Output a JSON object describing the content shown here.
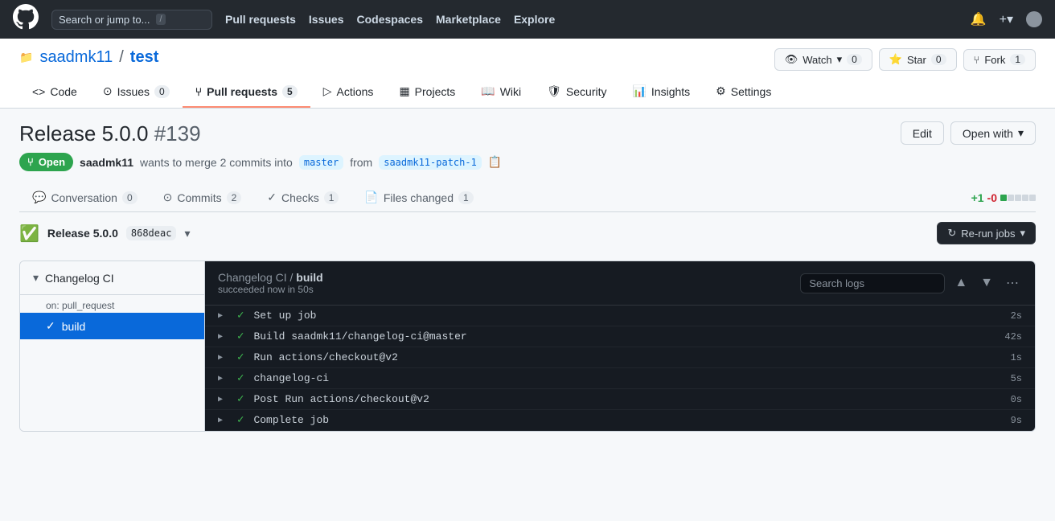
{
  "topnav": {
    "search_placeholder": "Search or jump to...",
    "slash_key": "/",
    "nav_items": [
      "Pull requests",
      "Issues",
      "Codespaces",
      "Marketplace",
      "Explore"
    ],
    "watch_label": "Watch",
    "watch_count": "0",
    "star_label": "Star",
    "star_count": "0",
    "fork_label": "Fork",
    "fork_count": "1"
  },
  "repo": {
    "owner": "saadmk11",
    "name": "test",
    "tabs": [
      {
        "icon": "code-icon",
        "label": "Code"
      },
      {
        "icon": "issues-icon",
        "label": "Issues",
        "count": "0"
      },
      {
        "icon": "pr-icon",
        "label": "Pull requests",
        "count": "5",
        "active": true
      },
      {
        "icon": "actions-icon",
        "label": "Actions"
      },
      {
        "icon": "projects-icon",
        "label": "Projects"
      },
      {
        "icon": "wiki-icon",
        "label": "Wiki"
      },
      {
        "icon": "security-icon",
        "label": "Security"
      },
      {
        "icon": "insights-icon",
        "label": "Insights"
      },
      {
        "icon": "settings-icon",
        "label": "Settings"
      }
    ]
  },
  "pr": {
    "title": "Release 5.0.0",
    "number": "#139",
    "status": "Open",
    "author": "saadmk11",
    "action": "wants to merge 2 commits into",
    "base_branch": "master",
    "from_text": "from",
    "head_branch": "saadmk11-patch-1",
    "tabs": [
      {
        "icon": "conversation-icon",
        "label": "Conversation",
        "count": "0"
      },
      {
        "icon": "commits-icon",
        "label": "Commits",
        "count": "2"
      },
      {
        "icon": "checks-icon",
        "label": "Checks",
        "count": "1"
      },
      {
        "icon": "files-icon",
        "label": "Files changed",
        "count": "1"
      }
    ],
    "diff_plus": "+1",
    "diff_minus": "-0",
    "edit_label": "Edit",
    "open_with_label": "Open with",
    "rerun_label": "Re-run jobs"
  },
  "checks": {
    "workflow_name": "Release 5.0.0",
    "check_hash": "868deac",
    "sidebar_group": "Changelog CI",
    "sidebar_on": "on: pull_request",
    "sidebar_item": "build",
    "main_breadcrumb_workflow": "Changelog CI",
    "main_breadcrumb_step": "build",
    "main_subtitle": "succeeded now in 50s",
    "search_placeholder": "Search logs",
    "log_steps": [
      {
        "name": "Set up job",
        "time": "2s"
      },
      {
        "name": "Build saadmk11/changelog-ci@master",
        "time": "42s"
      },
      {
        "name": "Run actions/checkout@v2",
        "time": "1s"
      },
      {
        "name": "changelog-ci",
        "time": "5s"
      },
      {
        "name": "Post Run actions/checkout@v2",
        "time": "0s"
      },
      {
        "name": "Complete job",
        "time": "9s"
      }
    ]
  }
}
